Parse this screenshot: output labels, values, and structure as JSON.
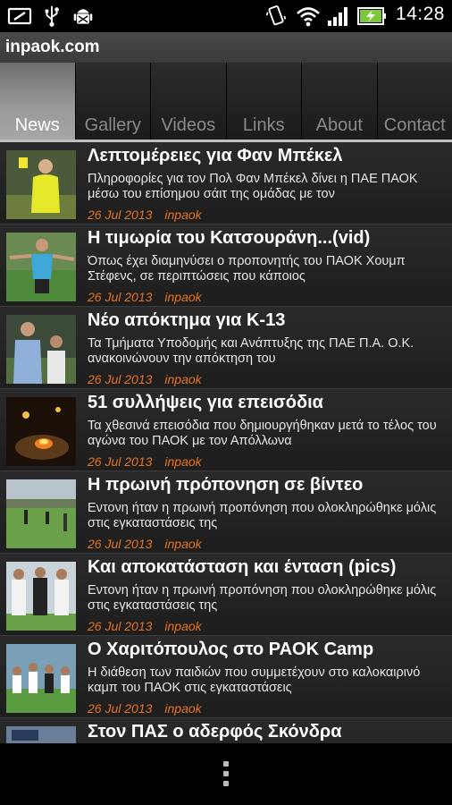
{
  "status_bar": {
    "time": "14:28",
    "icons": [
      "screenshot-icon",
      "usb-icon",
      "android-debug-icon",
      "vibrate-icon",
      "wifi-icon",
      "signal-icon",
      "battery-charging-icon"
    ]
  },
  "app": {
    "title": "inpaok.com"
  },
  "tabs": [
    {
      "label": "News",
      "active": true
    },
    {
      "label": "Gallery",
      "active": false
    },
    {
      "label": "Videos",
      "active": false
    },
    {
      "label": "Links",
      "active": false
    },
    {
      "label": "About",
      "active": false
    },
    {
      "label": "Contact",
      "active": false
    }
  ],
  "articles": [
    {
      "title": "Λεπτομέρειες για Φαν Μπέκελ",
      "desc": "Πληροφορίες για τον Πολ Φαν Μπέκελ δίνει η ΠΑΕ ΠΑΟΚ μέσω του επίσημου σάιτ της ομάδας με τον",
      "date": "26 Jul 2013",
      "author": "inpaok"
    },
    {
      "title": "Η τιμωρία του Κατσουράνη...(vid)",
      "desc": "Όπως έχει διαμηνύσει ο προπονητής του ΠΑΟΚ Χουμπ Στέφενς, σε περιπτώσεις που κάποιος",
      "date": "26 Jul 2013",
      "author": "inpaok"
    },
    {
      "title": "Νέο απόκτημα για Κ-13",
      "desc": "Τα Τμήματα Υποδομής και Ανάπτυξης της ΠΑΕ Π.Α. Ο.Κ. ανακοινώνουν την απόκτηση του",
      "date": "26 Jul 2013",
      "author": "inpaok"
    },
    {
      "title": "51 συλλήψεις για επεισόδια",
      "desc": "Τα χθεσινά επεισόδια που δημιουργήθηκαν μετά το τέλος του αγώνα του ΠΑΟΚ με τον Απόλλωνα",
      "date": "26 Jul 2013",
      "author": "inpaok"
    },
    {
      "title": "Η πρωινή πρόπονηση σε βίντεο",
      "desc": "Εντονη ήταν η πρωινή προπόνηση που ολοκληρώθηκε μόλις στις εγκαταστάσεις της",
      "date": "26 Jul 2013",
      "author": "inpaok"
    },
    {
      "title": "Και αποκατάσταση και ένταση (pics)",
      "desc": "Εντονη ήταν η πρωινή προπόνηση που ολοκληρώθηκε μόλις στις εγκαταστάσεις της",
      "date": "26 Jul 2013",
      "author": "inpaok"
    },
    {
      "title": "Ο Χαριτόπουλος στο PAOK Camp",
      "desc": "Η διάθεση των παιδιών που συμμετέχουν στο καλοκαιρινό καμπ του ΠΑΟΚ στις εγκαταστάσεις",
      "date": "26 Jul 2013",
      "author": "inpaok"
    },
    {
      "title": "Στον ΠΑΣ ο αδερφός Σκόνδρα",
      "desc": "",
      "date": "",
      "author": ""
    }
  ],
  "bottom_bar": {
    "icon": "overflow-menu-icon"
  }
}
